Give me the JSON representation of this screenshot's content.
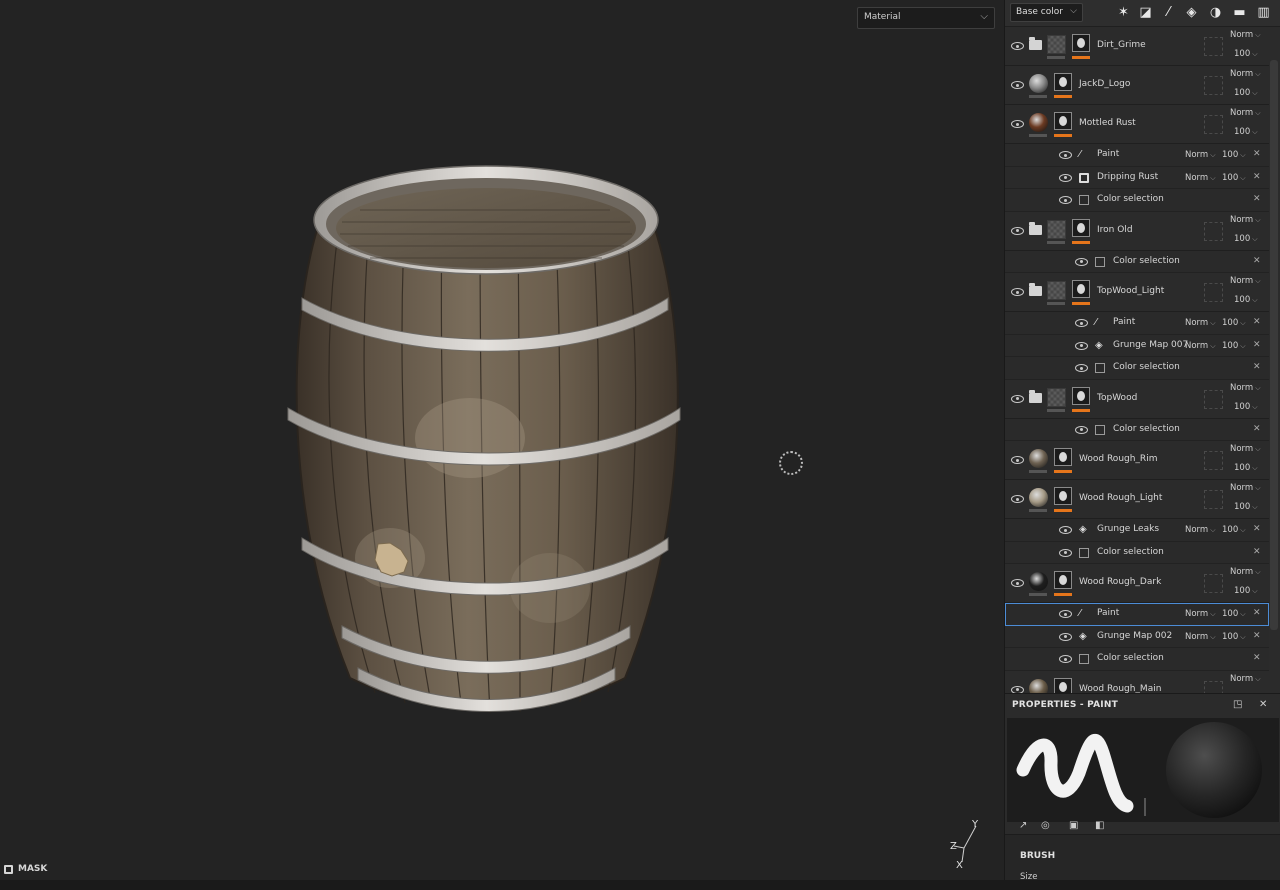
{
  "viewport": {
    "material_select": "Material",
    "mask_label": "MASK"
  },
  "layers_toolbar": {
    "channel_select": "Base color",
    "icons": [
      "magic-wand-icon",
      "smart-mask-icon",
      "brush-icon",
      "fill-bucket-icon",
      "material-ball-icon",
      "folder-icon",
      "trash-icon"
    ]
  },
  "layers": [
    {
      "name": "Dirt_Grime",
      "kind": "folder",
      "blend": "Norm",
      "opacity": "100",
      "effects": []
    },
    {
      "name": "JackD_Logo",
      "kind": "fill",
      "thumb_color": "#8a8a8a",
      "blend": "Norm",
      "opacity": "100",
      "effects": []
    },
    {
      "name": "Mottled Rust",
      "kind": "fill",
      "thumb_color": "#6b3a22",
      "blend": "Norm",
      "opacity": "100",
      "effects": [
        {
          "name": "Paint",
          "icon": "brush",
          "blend": "Norm",
          "opacity": "100"
        },
        {
          "name": "Dripping Rust",
          "icon": "mask",
          "blend": "Norm",
          "opacity": "100"
        },
        {
          "name": "Color selection",
          "icon": "box",
          "blend": "",
          "opacity": ""
        }
      ]
    },
    {
      "name": "Iron Old",
      "kind": "folder",
      "blend": "Norm",
      "opacity": "100",
      "effects": [
        {
          "name": "Color selection",
          "icon": "box",
          "blend": "",
          "opacity": ""
        }
      ]
    },
    {
      "name": "TopWood_Light",
      "kind": "folder",
      "blend": "Norm",
      "opacity": "100",
      "effects": [
        {
          "name": "Paint",
          "icon": "brush",
          "blend": "Norm",
          "opacity": "100"
        },
        {
          "name": "Grunge Map 007",
          "icon": "fill",
          "blend": "Norm",
          "opacity": "100"
        },
        {
          "name": "Color selection",
          "icon": "box",
          "blend": "",
          "opacity": ""
        }
      ]
    },
    {
      "name": "TopWood",
      "kind": "folder",
      "blend": "Norm",
      "opacity": "100",
      "effects": [
        {
          "name": "Color selection",
          "icon": "box",
          "blend": "",
          "opacity": ""
        }
      ]
    },
    {
      "name": "Wood Rough_Rim",
      "kind": "fill",
      "thumb_color": "#6e6252",
      "blend": "Norm",
      "opacity": "100",
      "effects": []
    },
    {
      "name": "Wood Rough_Light",
      "kind": "fill",
      "thumb_color": "#a59a86",
      "blend": "Norm",
      "opacity": "100",
      "effects": [
        {
          "name": "Grunge Leaks",
          "icon": "fill",
          "blend": "Norm",
          "opacity": "100"
        },
        {
          "name": "Color selection",
          "icon": "box",
          "blend": "",
          "opacity": ""
        }
      ]
    },
    {
      "name": "Wood Rough_Dark",
      "kind": "fill",
      "thumb_color": "#1e1e1e",
      "blend": "Norm",
      "opacity": "100",
      "effects": [
        {
          "name": "Paint",
          "icon": "brush",
          "blend": "Norm",
          "opacity": "100",
          "selected": true
        },
        {
          "name": "Grunge Map 002",
          "icon": "fill",
          "blend": "Norm",
          "opacity": "100"
        },
        {
          "name": "Color selection",
          "icon": "box",
          "blend": "",
          "opacity": ""
        }
      ]
    },
    {
      "name": "Wood Rough_Main",
      "kind": "fill",
      "thumb_color": "#6a5c48",
      "blend": "Norm",
      "opacity": "100",
      "effects": []
    }
  ],
  "properties": {
    "title": "PROPERTIES - PAINT",
    "brush_section": "BRUSH",
    "size_label": "Size"
  },
  "colors": {
    "accent_orange": "#e5751b",
    "selection_blue": "#4c8cd6",
    "panel_bg": "#2b2b2b",
    "viewport_bg": "#232323"
  }
}
